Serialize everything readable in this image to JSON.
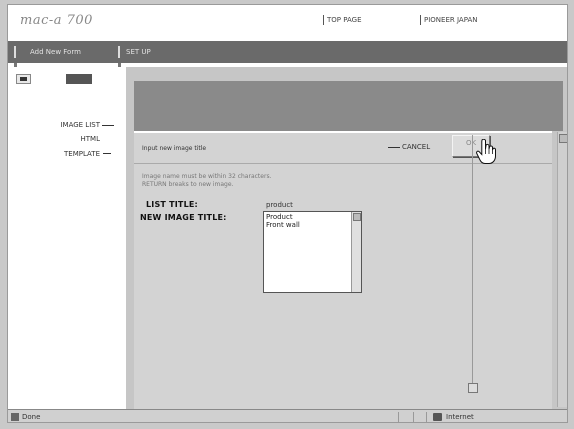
{
  "header": {
    "logo": "mac-a 700",
    "links": [
      "TOP PAGE",
      "PIONEER JAPAN"
    ]
  },
  "navbar": {
    "tabs": [
      "Add New Form",
      "SET UP"
    ]
  },
  "sidebar": {
    "tools": [
      "",
      "",
      ""
    ],
    "items": [
      "IMAGE LIST",
      "HTML",
      "TEMPLATE"
    ]
  },
  "panel": {
    "title": "Input new image title",
    "cancel_label": "CANCEL",
    "ok_label": "OK",
    "instructions": [
      "Image name must be within 32 characters.",
      "RETURN breaks to new image."
    ],
    "list_title_label": "LIST TITLE:",
    "list_title_value": "product",
    "new_title_label": "NEW IMAGE TITLE:",
    "new_title_lines": [
      "Product",
      "Front wall"
    ]
  },
  "statusbar": {
    "text": "Done",
    "zone": "Internet"
  },
  "colors": {
    "navbar": "#6a6a6a",
    "content_bg": "#c6c6c6",
    "content_top": "#8a8a8a",
    "panel_bg": "#d3d3d3"
  },
  "icons": [
    "hand-cursor-icon",
    "page-icon",
    "internet-zone-icon"
  ]
}
